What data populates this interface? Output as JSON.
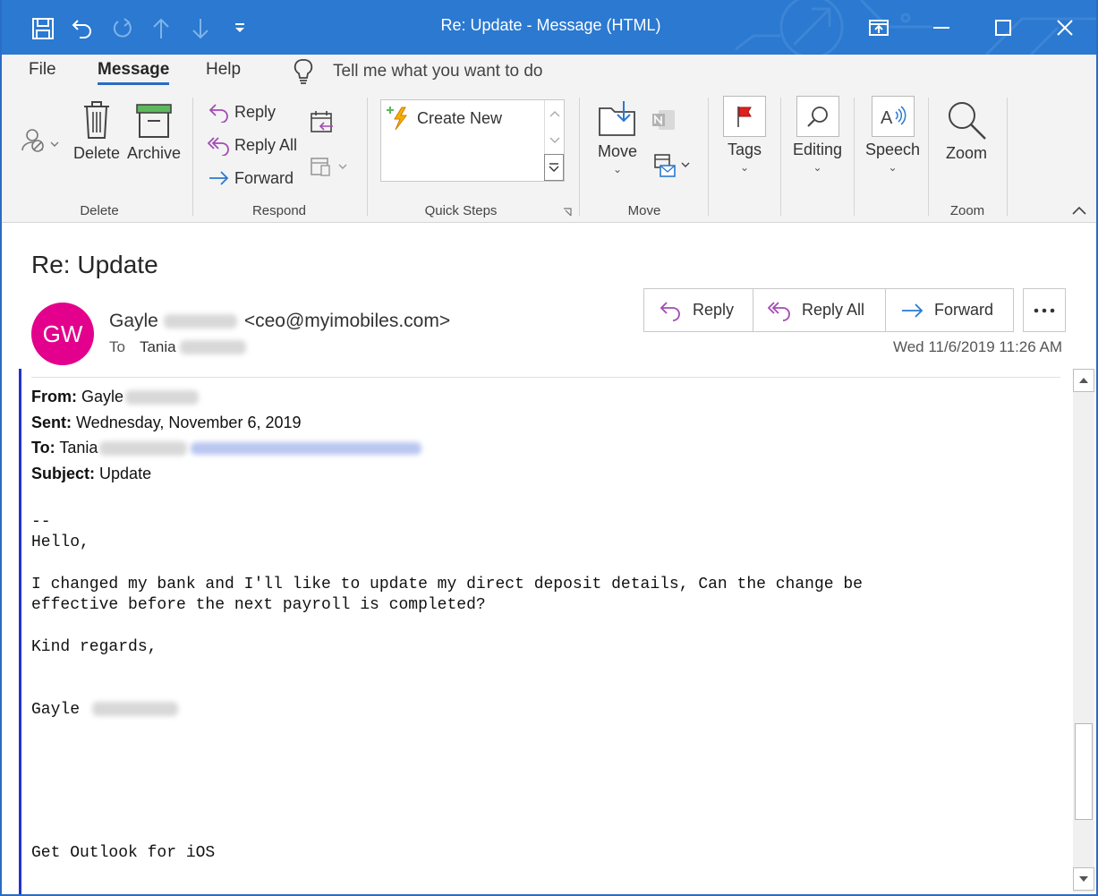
{
  "window": {
    "title": "Re: Update  -  Message (HTML)",
    "accent_color": "#2b79d0"
  },
  "quick_access": [
    "save-icon",
    "undo-icon",
    "redo-icon",
    "previous-item-icon",
    "next-item-icon",
    "customize-icon"
  ],
  "window_controls": [
    "restore-ribbon-icon",
    "minimize-icon",
    "maximize-icon",
    "close-icon"
  ],
  "menu": {
    "tabs": [
      {
        "label": "File"
      },
      {
        "label": "Message"
      },
      {
        "label": "Help"
      }
    ],
    "active_tab": "Message",
    "tell_me": "Tell me what you want to do"
  },
  "ribbon": {
    "delete_group": {
      "label": "Delete",
      "delete_label": "Delete",
      "archive_label": "Archive"
    },
    "respond_group": {
      "label": "Respond",
      "reply_label": "Reply",
      "reply_all_label": "Reply All",
      "forward_label": "Forward"
    },
    "quick_steps_group": {
      "label": "Quick Steps",
      "create_new_label": "Create New"
    },
    "move_group": {
      "label": "Move",
      "move_label": "Move"
    },
    "tags_group": {
      "tags_label": "Tags"
    },
    "editing_group": {
      "editing_label": "Editing"
    },
    "speech_group": {
      "speech_label": "Speech"
    },
    "zoom_group": {
      "label": "Zoom",
      "zoom_label": "Zoom"
    }
  },
  "message": {
    "subject": "Re: Update",
    "avatar_initials": "GW",
    "avatar_color": "#e3008c",
    "sender_first_name": "Gayle",
    "sender_email": "<ceo@myimobiles.com>",
    "to_label": "To",
    "to_name": "Tania",
    "datetime": "Wed 11/6/2019 11:26 AM",
    "actions": {
      "reply": "Reply",
      "reply_all": "Reply All",
      "forward": "Forward"
    }
  },
  "body": {
    "from_label": "From:",
    "from_value": "Gayle",
    "sent_label": "Sent:",
    "sent_value": "Wednesday, November 6, 2019",
    "to_label": "To:",
    "to_value": "Tania",
    "subject_label": "Subject:",
    "subject_value": "Update",
    "separator": "--",
    "greeting": "Hello,",
    "line1": "I changed my bank and I'll like to update my direct deposit details, Can the change be",
    "line2": "effective before the next payroll is completed?",
    "closing": "Kind regards,",
    "signature_name": "Gayle",
    "footer": "Get Outlook for iOS"
  }
}
